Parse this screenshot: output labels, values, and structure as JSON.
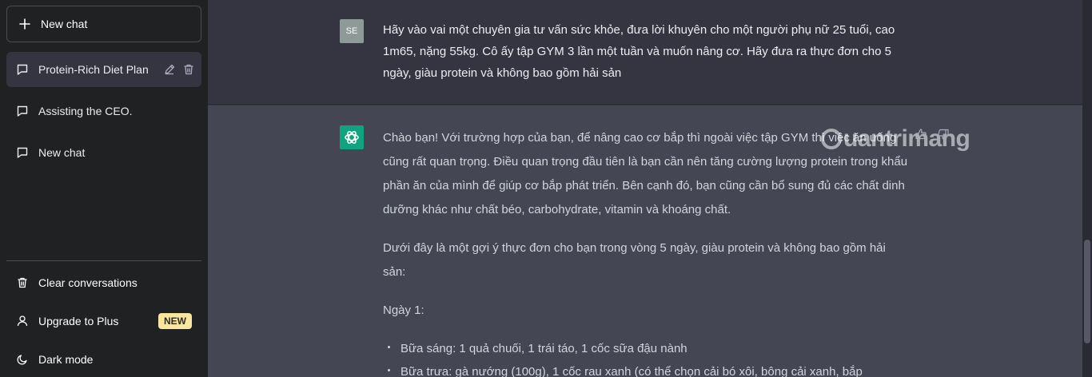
{
  "sidebar": {
    "new_chat": "New chat",
    "conversations": [
      {
        "label": "Protein-Rich Diet Plan",
        "active": true
      },
      {
        "label": "Assisting the CEO.",
        "active": false
      },
      {
        "label": "New chat",
        "active": false
      }
    ],
    "bottom": {
      "clear": "Clear conversations",
      "upgrade": "Upgrade to Plus",
      "upgrade_badge": "NEW",
      "dark_mode": "Dark mode"
    }
  },
  "user_message": {
    "avatar": "SE",
    "text": "Hãy vào vai một chuyên gia tư vấn sức khỏe, đưa lời khuyên cho một người phụ nữ 25 tuổi, cao 1m65, nặng 55kg. Cô ấy tập GYM 3 lần một tuần và muốn nâng cơ. Hãy đưa ra thực đơn cho 5 ngày, giàu protein và không bao gồm hải sản"
  },
  "bot_message": {
    "paragraphs": [
      "Chào bạn! Với trường hợp của bạn, để nâng cao cơ bắp thì ngoài việc tập GYM thì việc ăn uống cũng rất quan trọng. Điều quan trọng đầu tiên là bạn cần nên tăng cường lượng protein trong khẩu phần ăn của mình để giúp cơ bắp phát triển. Bên cạnh đó, bạn cũng cần bổ sung đủ các chất dinh dưỡng khác như chất béo, carbohydrate, vitamin và khoáng chất.",
      "Dưới đây là một gợi ý thực đơn cho bạn trong vòng 5 ngày, giàu protein và không bao gồm hải sản:",
      "Ngày 1:"
    ],
    "list": [
      "Bữa sáng: 1 quả chuối, 1 trái táo, 1 cốc sữa đậu nành",
      "Bữa trưa: gà nướng (100g), 1 cốc rau xanh (có thể chọn cải bó xôi, bông cải xanh, bắp"
    ]
  },
  "watermark": "uantrimang",
  "colors": {
    "sidebar_bg": "#202123",
    "main_bg": "#343541",
    "bot_bg": "#444654",
    "bot_avatar": "#10a37f",
    "badge": "#fae69e"
  }
}
